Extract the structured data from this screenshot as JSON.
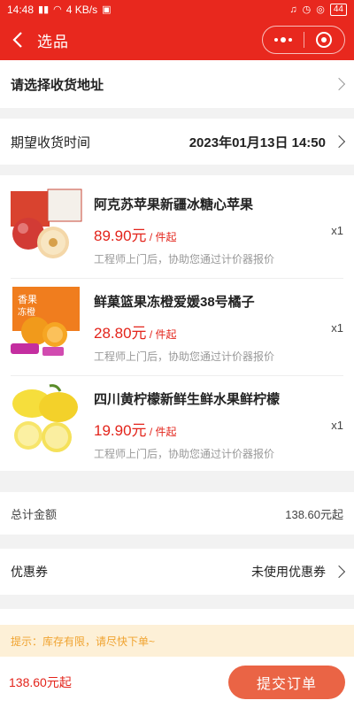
{
  "status_bar": {
    "time": "14:48",
    "net_speed": "4 KB/s",
    "battery": "44"
  },
  "nav": {
    "title": "选品"
  },
  "address": {
    "label": "请选择收货地址"
  },
  "delivery": {
    "label": "期望收货时间",
    "value": "2023年01月13日 14:50"
  },
  "products": [
    {
      "name": "阿克苏苹果新疆冰糖心苹果",
      "price": "89.90元",
      "unit": " / 件起",
      "note": "工程师上门后，协助您通过计价器报价",
      "qty": "x1",
      "thumb_icon": "apple-product-image"
    },
    {
      "name": "鲜菓篮果冻橙爱媛38号橘子",
      "price": "28.80元",
      "unit": " / 件起",
      "note": "工程师上门后，协助您通过计价器报价",
      "qty": "x1",
      "thumb_icon": "orange-product-image"
    },
    {
      "name": "四川黄柠檬新鲜生鲜水果鲜柠檬",
      "price": "19.90元",
      "unit": " / 件起",
      "note": "工程师上门后，协助您通过计价器报价",
      "qty": "x1",
      "thumb_icon": "lemon-product-image"
    }
  ],
  "total": {
    "label": "总计金额",
    "value": "138.60元起"
  },
  "coupon": {
    "label": "优惠券",
    "value": "未使用优惠券"
  },
  "tip": {
    "text": "提示：库存有限，请尽快下单~"
  },
  "bottom": {
    "sum": "138.60元起",
    "submit_label": "提交订单"
  },
  "colors": {
    "brand": "#e8281e",
    "price": "#e3241b",
    "submit": "#ea6445",
    "tip_bg": "#fdf0d7",
    "tip_text": "#f0a330"
  }
}
